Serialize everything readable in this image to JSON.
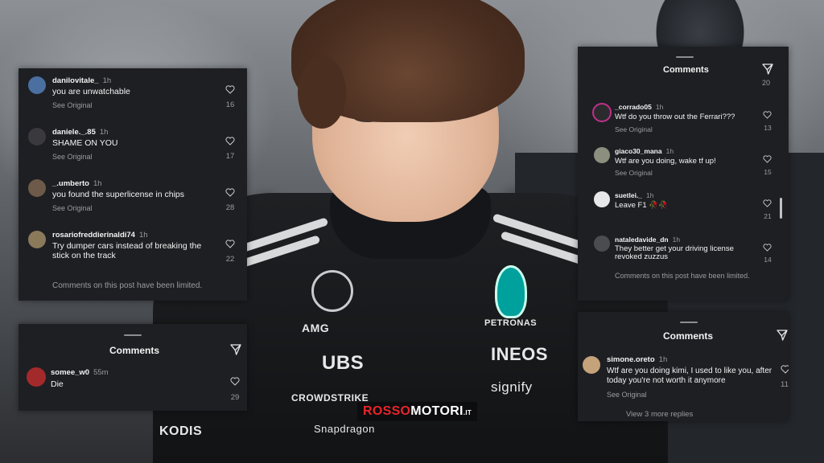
{
  "brand": {
    "part1": "ROSSO",
    "part2": "MOTORI",
    "suffix": ".IT"
  },
  "suit": {
    "amg": "AMG",
    "ubs": "UBS",
    "petronas": "PETRONAS",
    "ineos": "INEOS",
    "crowdstrike": "CROWDSTRIKE",
    "signify": "signify",
    "snapdragon": "Snapdragon",
    "kodis": "KODIS"
  },
  "panel_left_top": {
    "comments": [
      {
        "user": "danilovitale_",
        "age": "1h",
        "text": "you are unwatchable",
        "sub": "See Original",
        "likes": "16"
      },
      {
        "user": "daniele._.85",
        "age": "1h",
        "text": "SHAME ON YOU",
        "sub": "See Original",
        "likes": "17"
      },
      {
        "user": "_.umberto",
        "age": "1h",
        "text": "you found the superlicense in chips",
        "sub": "See Original",
        "likes": "28"
      },
      {
        "user": "rosariofreddierinaldi74",
        "age": "1h",
        "text": "Try dumper cars instead of breaking the stick on the track",
        "sub": "",
        "likes": "22"
      }
    ],
    "footer": "Comments on this post have been limited."
  },
  "panel_left_bottom": {
    "title": "Comments",
    "comments": [
      {
        "user": "somee_w0",
        "age": "55m",
        "text": "Die",
        "likes": "29"
      }
    ]
  },
  "panel_right_top": {
    "title": "Comments",
    "top_count": "20",
    "comments": [
      {
        "user": "_corrado05",
        "age": "1h",
        "text": "Wtf do you throw out the Ferrari???",
        "sub": "See Original",
        "likes": "13"
      },
      {
        "user": "giaco30_mana",
        "age": "1h",
        "text": "Wtf are you doing, wake tf up!",
        "sub": "See Original",
        "likes": "15"
      },
      {
        "user": "suetlei._",
        "age": "1h",
        "text": "Leave F1 🥀🥀",
        "sub": "",
        "likes": "21"
      },
      {
        "user": "nataledavide_dn",
        "age": "1h",
        "text": "They better get your driving license revoked zuzzus",
        "sub": "",
        "likes": "14"
      }
    ],
    "footer": "Comments on this post have been limited."
  },
  "panel_right_bottom": {
    "title": "Comments",
    "comments": [
      {
        "user": "simone.oreto",
        "age": "1h",
        "text": "Wtf are you doing kimi, I used to like you, after today you're not worth it anymore",
        "sub": "See Original",
        "likes": "117"
      }
    ],
    "view_replies": "View 3 more replies"
  },
  "icons": {
    "like": "heart-icon",
    "filter": "filter-send-icon"
  }
}
